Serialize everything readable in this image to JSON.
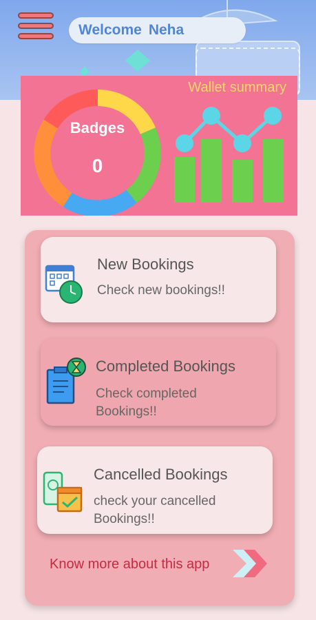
{
  "header": {
    "welcome_label": "Welcome",
    "user_name": "Neha",
    "menu_icon": "hamburger-menu-icon"
  },
  "wallet": {
    "title": "Wallet summary",
    "badges_label": "Badges",
    "badges_count": "0",
    "donut_colors": [
      "#ff5a5a",
      "#ffd84a",
      "#6ccf4e",
      "#46a9f2",
      "#ff8f3a"
    ],
    "bar_color": "#6ccf4e",
    "line_color": "#5cd6e6"
  },
  "cards": [
    {
      "title": "New Bookings",
      "subtitle": "Check new bookings!!",
      "icon": "calendar-clock-icon"
    },
    {
      "title": "Completed Bookings",
      "subtitle_line1": "Check completed",
      "subtitle_line2": "Bookings!!",
      "icon": "clipboard-hourglass-icon"
    },
    {
      "title": "Cancelled Bookings",
      "subtitle_line1": "check your cancelled",
      "subtitle_line2": "Bookings!!",
      "icon": "phone-calendar-check-icon"
    }
  ],
  "footer": {
    "know_more": "Know more about this app",
    "arrow_icon": "double-chevron-right-icon"
  }
}
